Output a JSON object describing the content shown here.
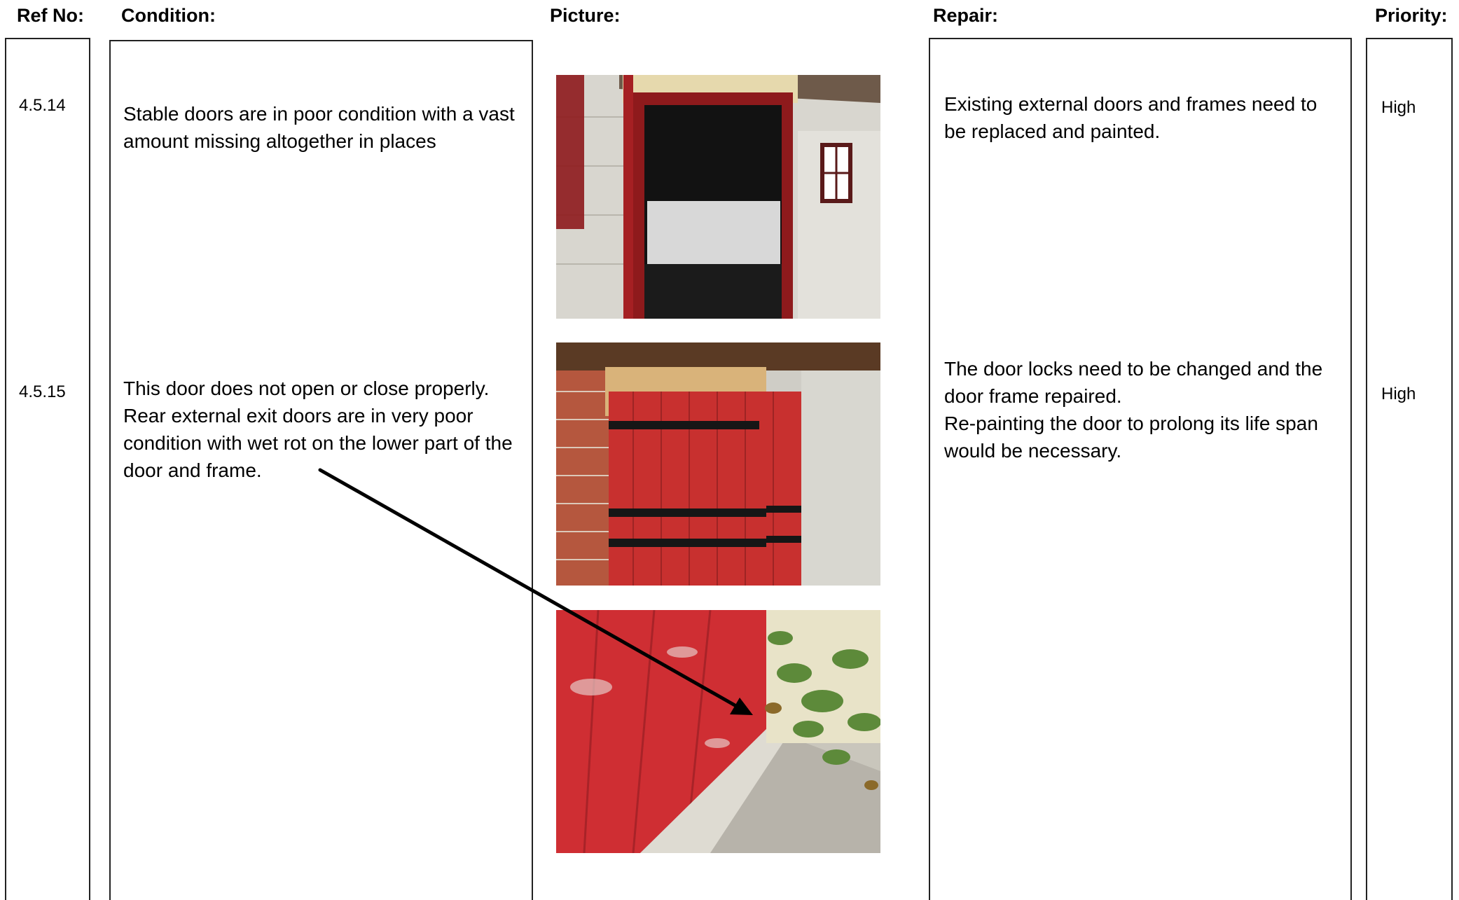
{
  "headers": {
    "ref": "Ref No:",
    "condition": "Condition:",
    "picture": "Picture:",
    "repair": "Repair:",
    "priority": "Priority:"
  },
  "rows": [
    {
      "ref": "4.5.14",
      "condition": "Stable doors are in poor condition with a vast amount missing altogether in places",
      "repair": "Existing external doors and frames need to be replaced and painted.",
      "priority": "High"
    },
    {
      "ref": "4.5.15",
      "condition": "This door does not open or close properly. Rear external exit doors are in very poor condition with wet rot on the lower part of the door and frame.",
      "repair_lines": [
        "The door locks need to be changed and the door frame repaired.",
        "Re-painting the door to prolong its life span would be necessary."
      ],
      "priority": "High"
    }
  ],
  "pictures": [
    {
      "subject": "stable-doorway-photo"
    },
    {
      "subject": "red-door-photo"
    },
    {
      "subject": "door-wet-rot-photo"
    }
  ],
  "colors": {
    "door_red": "#c8302f",
    "frame_red": "#8e1a1c",
    "wall_grey": "#d9d7d0",
    "border": "#222222"
  }
}
